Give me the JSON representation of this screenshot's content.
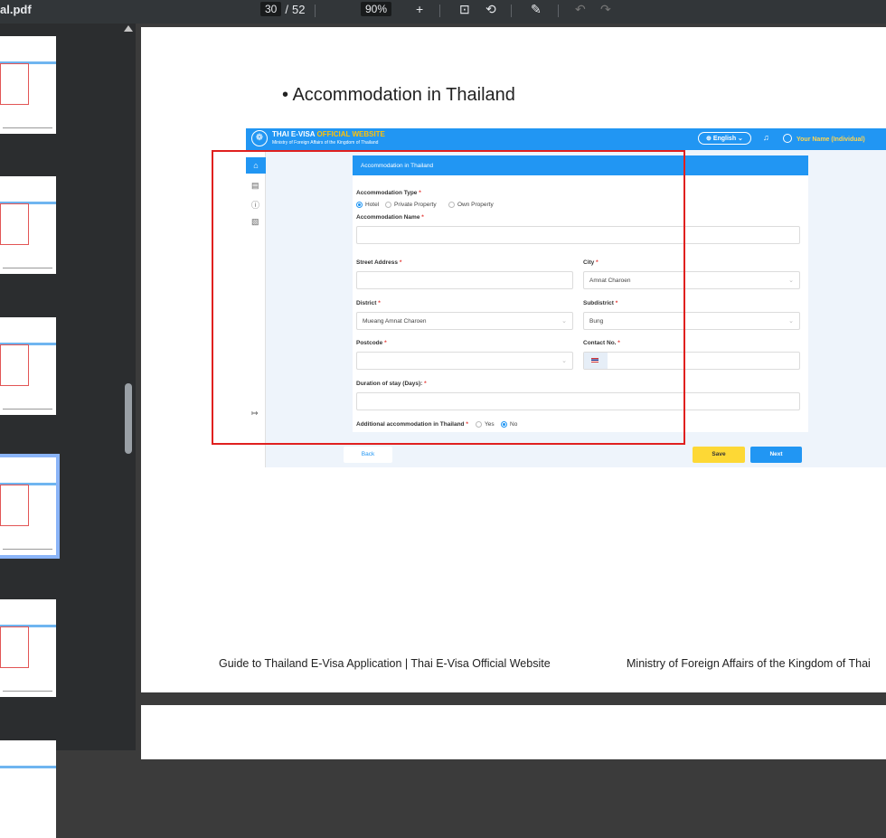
{
  "toolbar": {
    "file_name": "al.pdf",
    "current_page": "30",
    "page_sep": "/",
    "total_pages": "52",
    "zoom": "90%",
    "plus": "+",
    "icons": [
      "fit-page-icon",
      "rotate-icon",
      "annotate-icon",
      "undo-icon",
      "redo-icon"
    ]
  },
  "page": {
    "heading": "• Accommodation in Thailand",
    "footer_left": "Guide to Thailand E-Visa Application | Thai E-Visa Official Website",
    "footer_right": "Ministry of Foreign Affairs of the Kingdom of Thai"
  },
  "site": {
    "title_main": "THAI E-VISA ",
    "title_accent": "OFFICIAL WEBSITE",
    "subtitle": "Ministry of Foreign Affairs of the Kingdom of Thailand",
    "language": "English",
    "user": "Your Name  (Individual)",
    "primary_color": "#2196f3",
    "accent_color": "#ffc107"
  },
  "form": {
    "card_title": "Accommodation in Thailand",
    "accommodation_type_label": "Accommodation Type",
    "type_options": [
      {
        "label": "Hotel",
        "selected": true
      },
      {
        "label": "Private Property",
        "selected": false
      },
      {
        "label": "Own Property",
        "selected": false
      }
    ],
    "accommodation_name_label": "Accommodation Name",
    "accommodation_name_value": "",
    "street_address_label": "Street Address",
    "street_address_value": "",
    "city_label": "City",
    "city_value": "Amnat Charoen",
    "district_label": "District",
    "district_value": "Mueang Amnat Charoen",
    "subdistrict_label": "Subdistrict",
    "subdistrict_value": "Bung",
    "postcode_label": "Postcode",
    "postcode_value": "",
    "contact_label": "Contact No.",
    "contact_value": "",
    "duration_label": "Duration of stay (Days):",
    "duration_value": "",
    "additional_label": "Additional accommodation in Thailand",
    "additional_options": [
      {
        "label": "Yes",
        "selected": false
      },
      {
        "label": "No",
        "selected": true
      }
    ],
    "required_mark": "*",
    "back_label": "Back",
    "save_label": "Save",
    "next_label": "Next"
  }
}
